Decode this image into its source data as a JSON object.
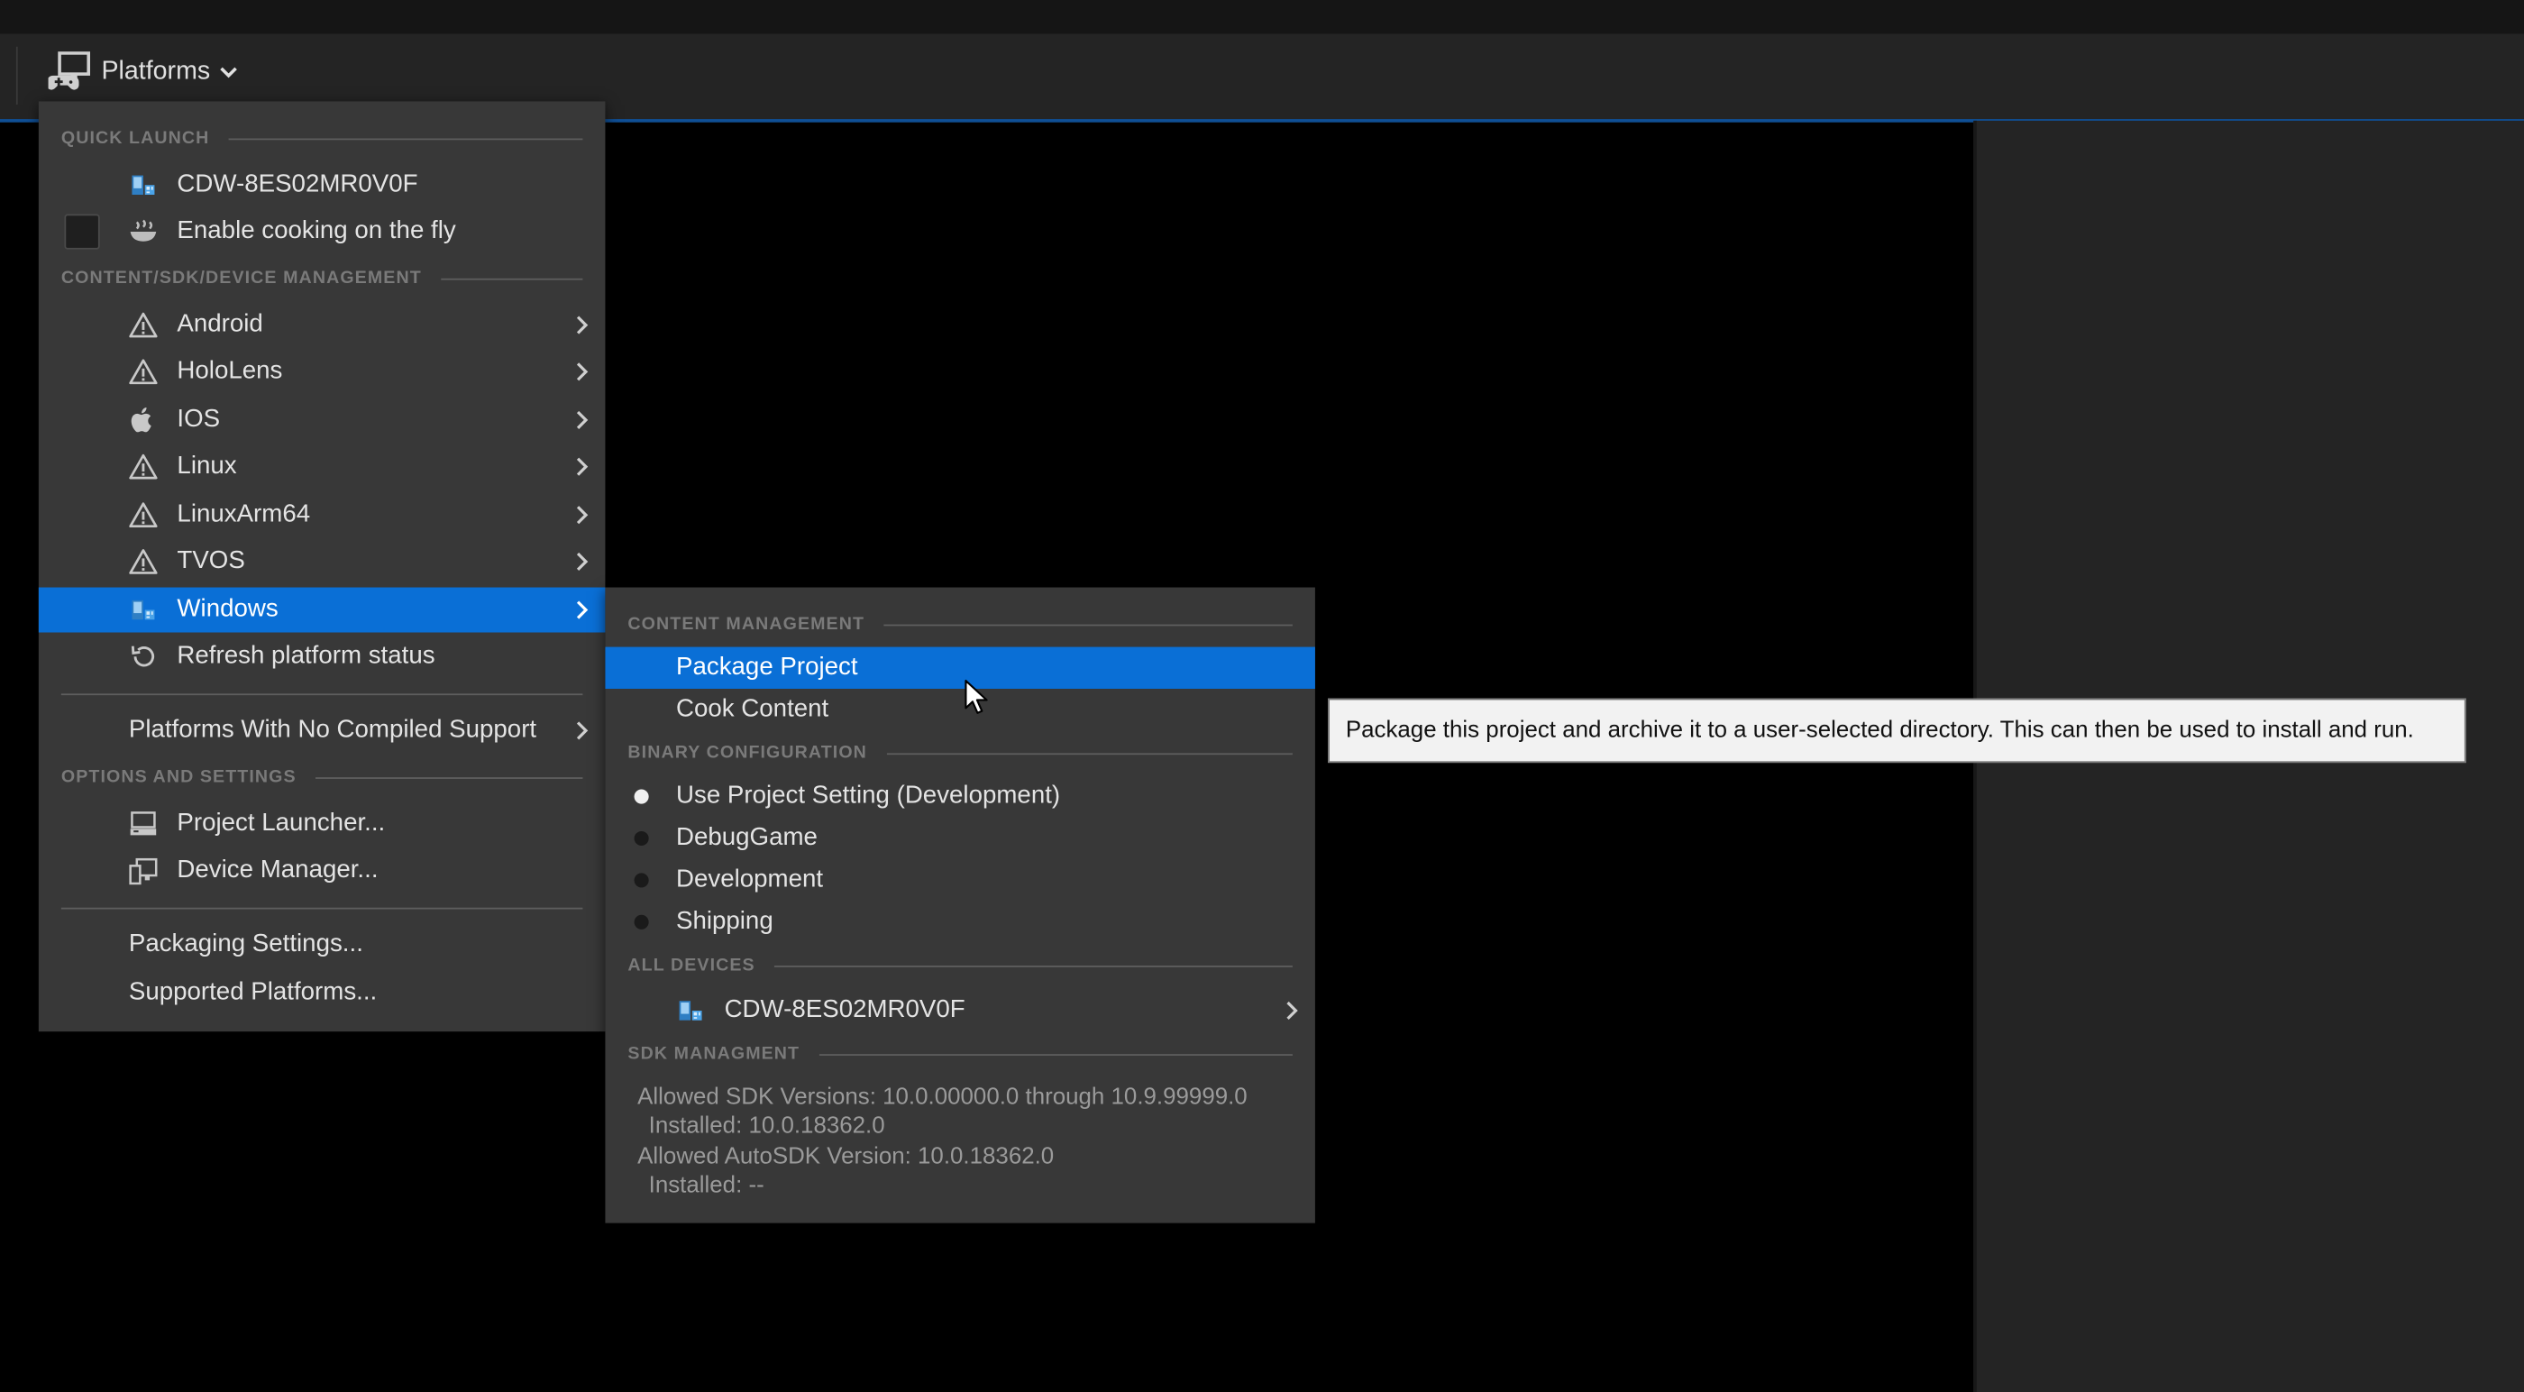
{
  "toolbar": {
    "platforms_label": "Platforms"
  },
  "main_menu": {
    "quick_launch_header": "QUICK LAUNCH",
    "device_item": "CDW-8ES02MR0V0F",
    "enable_cooking": "Enable cooking on the fly",
    "content_header": "CONTENT/SDK/DEVICE MANAGEMENT",
    "platforms": [
      {
        "label": "Android",
        "icon": "warning-icon"
      },
      {
        "label": "HoloLens",
        "icon": "warning-icon"
      },
      {
        "label": "IOS",
        "icon": "apple-icon"
      },
      {
        "label": "Linux",
        "icon": "warning-icon"
      },
      {
        "label": "LinuxArm64",
        "icon": "warning-icon"
      },
      {
        "label": "TVOS",
        "icon": "warning-icon"
      },
      {
        "label": "Windows",
        "icon": "windows-device-icon"
      }
    ],
    "refresh": "Refresh platform status",
    "no_compiled": "Platforms With No Compiled Support",
    "options_header": "OPTIONS AND SETTINGS",
    "project_launcher": "Project Launcher...",
    "device_manager": "Device Manager...",
    "packaging_settings": "Packaging Settings...",
    "supported_platforms": "Supported Platforms..."
  },
  "sub_menu": {
    "content_header": "CONTENT MANAGEMENT",
    "package_project": "Package Project",
    "cook_content": "Cook Content",
    "binary_header": "BINARY CONFIGURATION",
    "configs": [
      {
        "label": "Use Project Setting (Development)",
        "selected": true
      },
      {
        "label": "DebugGame",
        "selected": false
      },
      {
        "label": "Development",
        "selected": false
      },
      {
        "label": "Shipping",
        "selected": false
      }
    ],
    "devices_header": "ALL DEVICES",
    "device": "CDW-8ES02MR0V0F",
    "sdk_header": "SDK MANAGMENT",
    "sdk_lines": [
      "Allowed SDK Versions: 10.0.00000.0 through 10.9.99999.0",
      "Installed: 10.0.18362.0",
      "Allowed AutoSDK Version: 10.0.18362.0",
      "Installed: --"
    ]
  },
  "tooltip": "Package this project and archive it to a user-selected directory. This can then be used to install and run.",
  "colors": {
    "highlight": "#0a6fd6",
    "menu_bg": "#383838",
    "toolbar_bg": "#242424"
  }
}
